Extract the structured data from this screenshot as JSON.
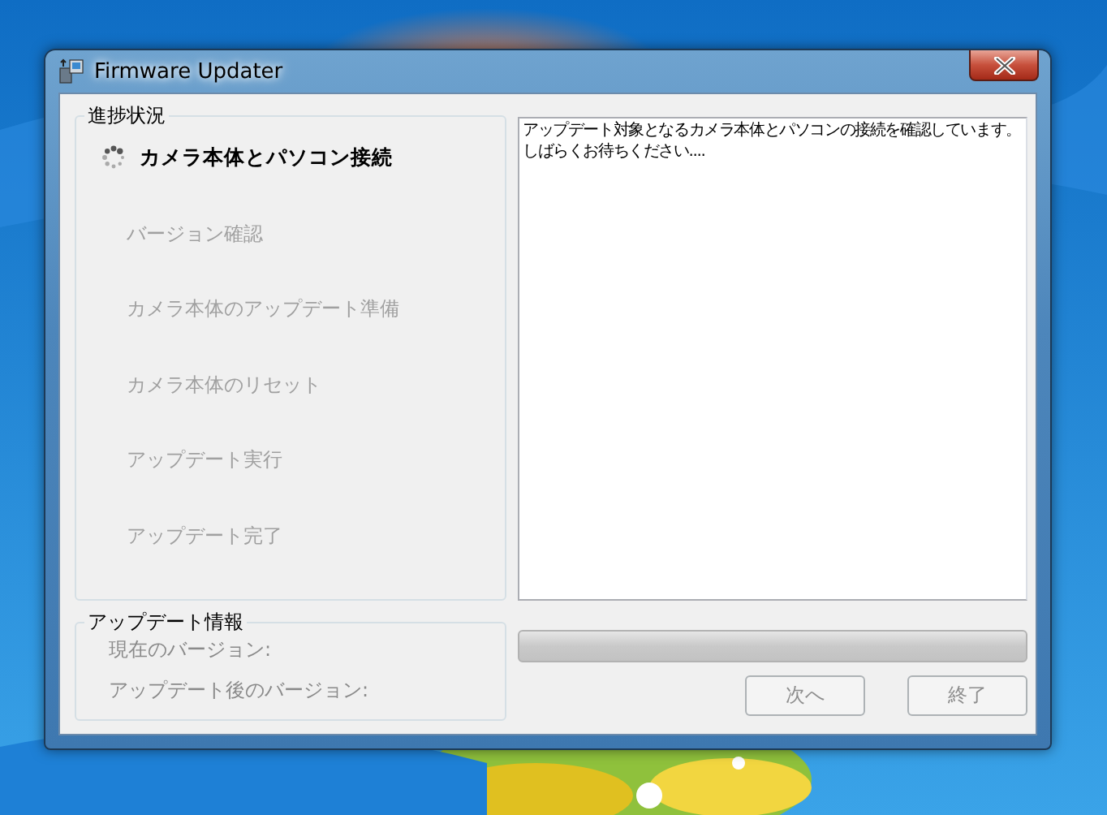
{
  "window": {
    "title": "Firmware Updater"
  },
  "progress_group": {
    "title": "進捗状況",
    "steps": [
      {
        "label": "カメラ本体とパソコン接続",
        "kind": "current"
      },
      {
        "label": "バージョン確認",
        "kind": "pending"
      },
      {
        "label": "カメラ本体のアップデート準備",
        "kind": "pending"
      },
      {
        "label": "カメラ本体のリセット",
        "kind": "pending"
      },
      {
        "label": "アップデート実行",
        "kind": "pending"
      },
      {
        "label": "アップデート完了",
        "kind": "pending"
      }
    ]
  },
  "message": {
    "lines": [
      "アップデート対象となるカメラ本体とパソコンの接続を確認しています。",
      "しばらくお待ちください...."
    ]
  },
  "info_group": {
    "title": "アップデート情報",
    "fields": [
      {
        "label": "現在のバージョン:",
        "disabled": true
      },
      {
        "label": "アップデート後のバージョン:",
        "disabled": true
      }
    ]
  },
  "progress": {
    "level": 0
  },
  "buttons": [
    {
      "label": "次へ",
      "disabled": true
    },
    {
      "label": "終了",
      "disabled": true
    }
  ]
}
